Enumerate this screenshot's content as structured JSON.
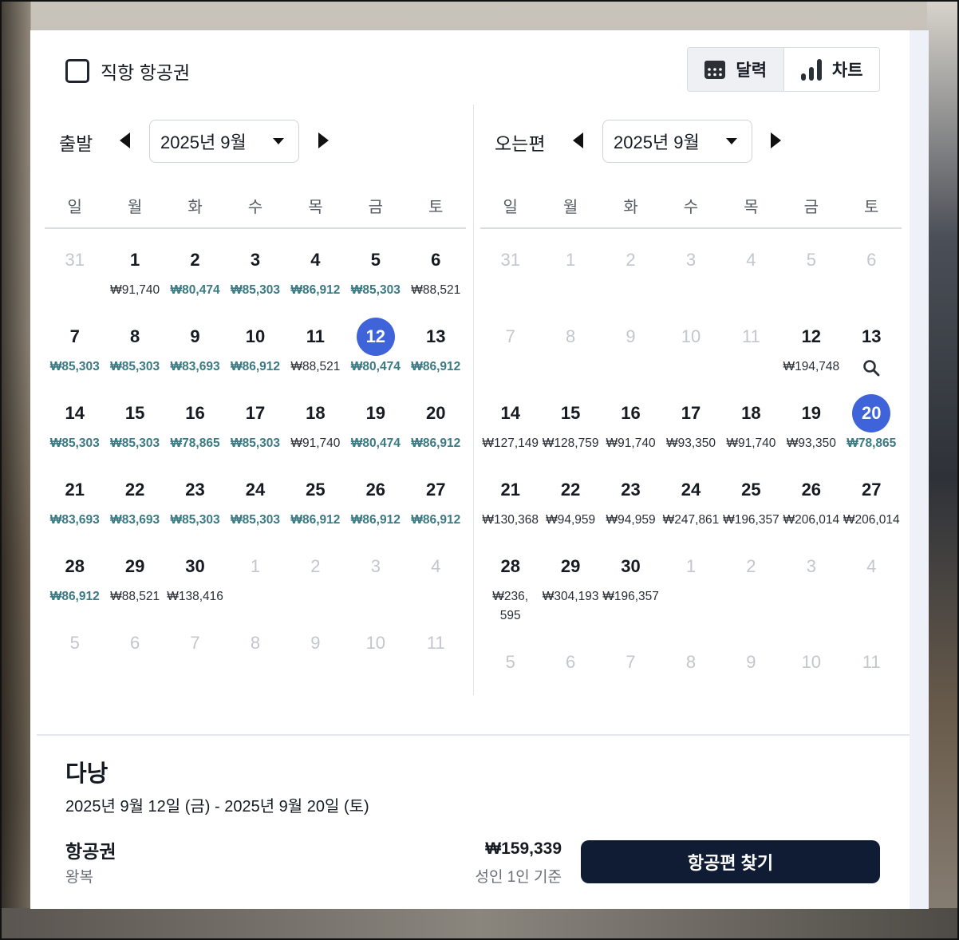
{
  "filter": {
    "direct_label": "직항 항공권",
    "direct_checked": false
  },
  "view_toggle": [
    {
      "label": "달력",
      "icon": "calendar-icon",
      "active": true
    },
    {
      "label": "차트",
      "icon": "bar-chart-icon",
      "active": false
    }
  ],
  "colors": {
    "selected": "#3f63d8",
    "low_price": "#3a7a84",
    "primary_button": "#0f1c33"
  },
  "weekdays": [
    "일",
    "월",
    "화",
    "수",
    "목",
    "금",
    "토"
  ],
  "departure": {
    "title": "출발",
    "month": "2025년 9월",
    "weeks": [
      [
        {
          "d": "31",
          "dim": true
        },
        {
          "d": "1",
          "p": "₩91,740"
        },
        {
          "d": "2",
          "p": "₩80,474",
          "low": true
        },
        {
          "d": "3",
          "p": "₩85,303",
          "low": true
        },
        {
          "d": "4",
          "p": "₩86,912",
          "low": true
        },
        {
          "d": "5",
          "p": "₩85,303",
          "low": true
        },
        {
          "d": "6",
          "p": "₩88,521"
        }
      ],
      [
        {
          "d": "7",
          "p": "₩85,303",
          "low": true
        },
        {
          "d": "8",
          "p": "₩85,303",
          "low": true
        },
        {
          "d": "9",
          "p": "₩83,693",
          "low": true
        },
        {
          "d": "10",
          "p": "₩86,912",
          "low": true
        },
        {
          "d": "11",
          "p": "₩88,521"
        },
        {
          "d": "12",
          "p": "₩80,474",
          "low": true,
          "sel": true
        },
        {
          "d": "13",
          "p": "₩86,912",
          "low": true
        }
      ],
      [
        {
          "d": "14",
          "p": "₩85,303",
          "low": true
        },
        {
          "d": "15",
          "p": "₩85,303",
          "low": true
        },
        {
          "d": "16",
          "p": "₩78,865",
          "low": true
        },
        {
          "d": "17",
          "p": "₩85,303",
          "low": true
        },
        {
          "d": "18",
          "p": "₩91,740"
        },
        {
          "d": "19",
          "p": "₩80,474",
          "low": true
        },
        {
          "d": "20",
          "p": "₩86,912",
          "low": true
        }
      ],
      [
        {
          "d": "21",
          "p": "₩83,693",
          "low": true
        },
        {
          "d": "22",
          "p": "₩83,693",
          "low": true
        },
        {
          "d": "23",
          "p": "₩85,303",
          "low": true
        },
        {
          "d": "24",
          "p": "₩85,303",
          "low": true
        },
        {
          "d": "25",
          "p": "₩86,912",
          "low": true
        },
        {
          "d": "26",
          "p": "₩86,912",
          "low": true
        },
        {
          "d": "27",
          "p": "₩86,912",
          "low": true
        }
      ],
      [
        {
          "d": "28",
          "p": "₩86,912",
          "low": true
        },
        {
          "d": "29",
          "p": "₩88,521"
        },
        {
          "d": "30",
          "p": "₩138,416"
        },
        {
          "d": "1",
          "dim": true
        },
        {
          "d": "2",
          "dim": true
        },
        {
          "d": "3",
          "dim": true
        },
        {
          "d": "4",
          "dim": true
        }
      ],
      [
        {
          "d": "5",
          "dim": true
        },
        {
          "d": "6",
          "dim": true
        },
        {
          "d": "7",
          "dim": true
        },
        {
          "d": "8",
          "dim": true
        },
        {
          "d": "9",
          "dim": true
        },
        {
          "d": "10",
          "dim": true
        },
        {
          "d": "11",
          "dim": true
        }
      ]
    ]
  },
  "return": {
    "title": "오는편",
    "month": "2025년 9월",
    "weeks": [
      [
        {
          "d": "31",
          "dim": true
        },
        {
          "d": "1",
          "dim": true
        },
        {
          "d": "2",
          "dim": true
        },
        {
          "d": "3",
          "dim": true
        },
        {
          "d": "4",
          "dim": true
        },
        {
          "d": "5",
          "dim": true
        },
        {
          "d": "6",
          "dim": true
        }
      ],
      [
        {
          "d": "7",
          "dim": true
        },
        {
          "d": "8",
          "dim": true
        },
        {
          "d": "9",
          "dim": true
        },
        {
          "d": "10",
          "dim": true
        },
        {
          "d": "11",
          "dim": true
        },
        {
          "d": "12",
          "p": "₩194,748"
        },
        {
          "d": "13",
          "search": true
        }
      ],
      [
        {
          "d": "14",
          "p": "₩127,149"
        },
        {
          "d": "15",
          "p": "₩128,759"
        },
        {
          "d": "16",
          "p": "₩91,740"
        },
        {
          "d": "17",
          "p": "₩93,350"
        },
        {
          "d": "18",
          "p": "₩91,740"
        },
        {
          "d": "19",
          "p": "₩93,350"
        },
        {
          "d": "20",
          "p": "₩78,865",
          "low": true,
          "sel": true
        }
      ],
      [
        {
          "d": "21",
          "p": "₩130,368"
        },
        {
          "d": "22",
          "p": "₩94,959"
        },
        {
          "d": "23",
          "p": "₩94,959"
        },
        {
          "d": "24",
          "p": "₩247,861"
        },
        {
          "d": "25",
          "p": "₩196,357"
        },
        {
          "d": "26",
          "p": "₩206,014"
        },
        {
          "d": "27",
          "p": "₩206,014"
        }
      ],
      [
        {
          "d": "28",
          "p": "₩236,\n595"
        },
        {
          "d": "29",
          "p": "₩304,193"
        },
        {
          "d": "30",
          "p": "₩196,357"
        },
        {
          "d": "1",
          "dim": true
        },
        {
          "d": "2",
          "dim": true
        },
        {
          "d": "3",
          "dim": true
        },
        {
          "d": "4",
          "dim": true
        }
      ],
      [
        {
          "d": "5",
          "dim": true
        },
        {
          "d": "6",
          "dim": true
        },
        {
          "d": "7",
          "dim": true
        },
        {
          "d": "8",
          "dim": true
        },
        {
          "d": "9",
          "dim": true
        },
        {
          "d": "10",
          "dim": true
        },
        {
          "d": "11",
          "dim": true
        }
      ]
    ]
  },
  "summary": {
    "destination": "다낭",
    "dates": "2025년 9월 12일 (금) - 2025년 9월 20일 (토)",
    "ticket_label": "항공권",
    "trip_type": "왕복",
    "total": "₩159,339",
    "basis": "성인 1인 기준",
    "find_button": "항공편 찾기"
  }
}
